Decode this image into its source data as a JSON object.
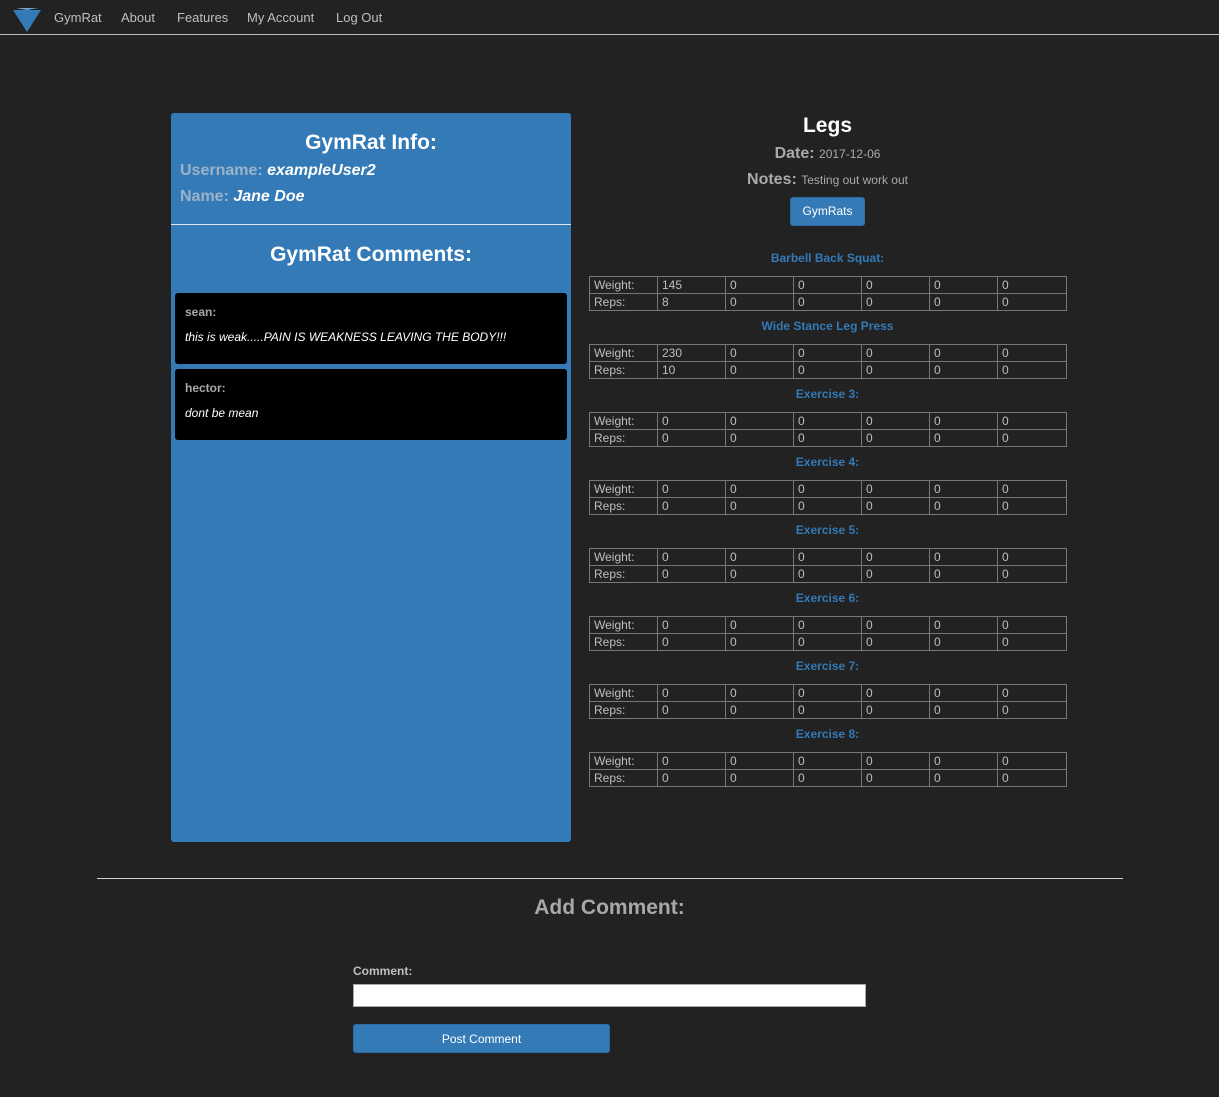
{
  "nav": {
    "brand": "GymRat",
    "links": [
      "About",
      "Features",
      "My Account",
      "Log Out"
    ]
  },
  "info": {
    "title": "GymRat Info:",
    "username_label": "Username:",
    "username": "exampleUser2",
    "name_label": "Name:",
    "name": "Jane Doe"
  },
  "comments": {
    "title": "GymRat Comments:",
    "items": [
      {
        "author": "sean:",
        "text": "this is weak.....PAIN IS WEAKNESS LEAVING THE BODY!!!"
      },
      {
        "author": "hector:",
        "text": "dont be mean"
      }
    ]
  },
  "workout": {
    "title": "Legs",
    "date_label": "Date:",
    "date": "2017-12-06",
    "notes_label": "Notes:",
    "notes": "Testing out work out",
    "button": "GymRats",
    "weight_label": "Weight:",
    "reps_label": "Reps:",
    "exercises": [
      {
        "name": "Barbell Back Squat:",
        "weight": [
          "145",
          "0",
          "0",
          "0",
          "0",
          "0"
        ],
        "reps": [
          "8",
          "0",
          "0",
          "0",
          "0",
          "0"
        ]
      },
      {
        "name": "Wide Stance Leg Press",
        "weight": [
          "230",
          "0",
          "0",
          "0",
          "0",
          "0"
        ],
        "reps": [
          "10",
          "0",
          "0",
          "0",
          "0",
          "0"
        ]
      },
      {
        "name": "Exercise 3:",
        "weight": [
          "0",
          "0",
          "0",
          "0",
          "0",
          "0"
        ],
        "reps": [
          "0",
          "0",
          "0",
          "0",
          "0",
          "0"
        ]
      },
      {
        "name": "Exercise 4:",
        "weight": [
          "0",
          "0",
          "0",
          "0",
          "0",
          "0"
        ],
        "reps": [
          "0",
          "0",
          "0",
          "0",
          "0",
          "0"
        ]
      },
      {
        "name": "Exercise 5:",
        "weight": [
          "0",
          "0",
          "0",
          "0",
          "0",
          "0"
        ],
        "reps": [
          "0",
          "0",
          "0",
          "0",
          "0",
          "0"
        ]
      },
      {
        "name": "Exercise 6:",
        "weight": [
          "0",
          "0",
          "0",
          "0",
          "0",
          "0"
        ],
        "reps": [
          "0",
          "0",
          "0",
          "0",
          "0",
          "0"
        ]
      },
      {
        "name": "Exercise 7:",
        "weight": [
          "0",
          "0",
          "0",
          "0",
          "0",
          "0"
        ],
        "reps": [
          "0",
          "0",
          "0",
          "0",
          "0",
          "0"
        ]
      },
      {
        "name": "Exercise 8:",
        "weight": [
          "0",
          "0",
          "0",
          "0",
          "0",
          "0"
        ],
        "reps": [
          "0",
          "0",
          "0",
          "0",
          "0",
          "0"
        ]
      }
    ]
  },
  "add_comment": {
    "title": "Add Comment:",
    "label": "Comment:",
    "value": "",
    "button": "Post Comment"
  },
  "colors": {
    "background": "#222222",
    "accent": "#337ab7",
    "card": "#000000"
  },
  "icons": {
    "logo": "triangle-logo-icon"
  }
}
